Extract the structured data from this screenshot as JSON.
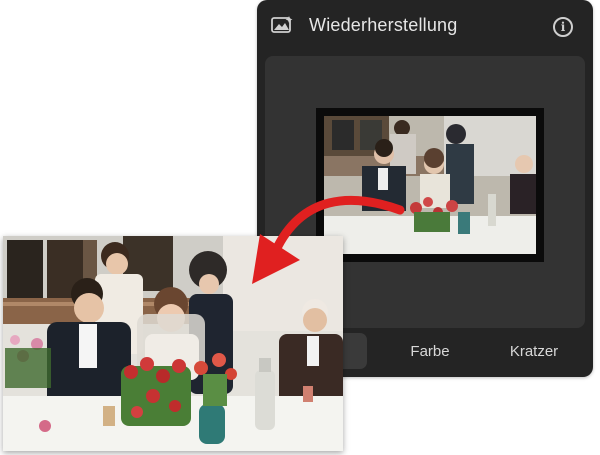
{
  "panel": {
    "title": "Wiederherstellung",
    "header_icon": "image-enhance-icon",
    "info_icon": "info-icon",
    "info_glyph": "i"
  },
  "segments": [
    {
      "label": "",
      "selected": true
    },
    {
      "label": "Farbe",
      "selected": false
    },
    {
      "label": "Kratzer",
      "selected": false
    }
  ],
  "colors": {
    "panel_bg": "#242424",
    "preview_bg": "#333333",
    "arrow": "#e02020"
  }
}
